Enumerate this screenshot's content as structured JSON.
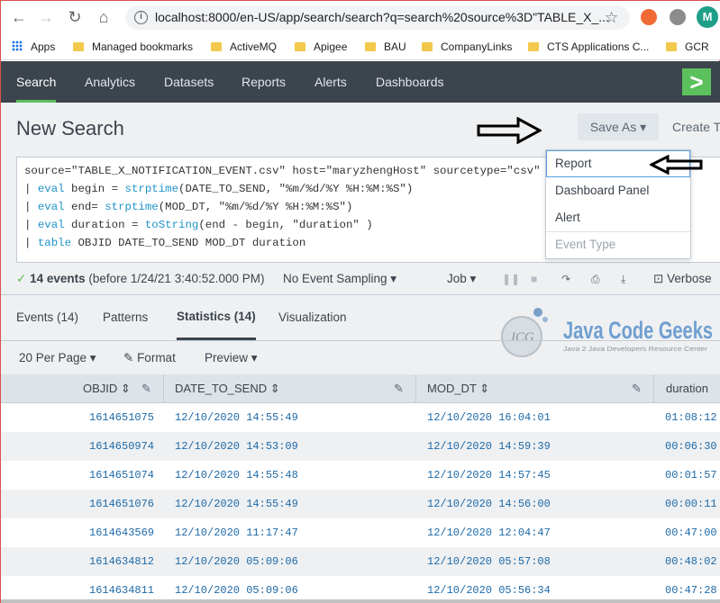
{
  "browser": {
    "url": "localhost:8000/en-US/app/search/search?q=search%20source%3D\"TABLE_X_...",
    "profile_initial": "M",
    "bookmarks": [
      "Apps",
      "Managed bookmarks",
      "ActiveMQ",
      "Apigee",
      "BAU",
      "CompanyLinks",
      "CTS Applications C...",
      "GCR"
    ]
  },
  "appbar": {
    "tabs": [
      "Search",
      "Analytics",
      "Datasets",
      "Reports",
      "Alerts",
      "Dashboards"
    ]
  },
  "page": {
    "title": "New Search",
    "save_as_label": "Save As ▾",
    "create_label": "Create T"
  },
  "search": {
    "line1": "source=\"TABLE_X_NOTIFICATION_EVENT.csv\" host=\"maryzhengHost\" sourcetype=\"csv\"",
    "line2_kw": "eval",
    "line2_rest": " begin = ",
    "line2_fn": "strptime",
    "line2_args": "(DATE_TO_SEND, \"%m/%d/%Y %H:%M:%S\")",
    "line3_kw": "eval",
    "line3_rest": " end= ",
    "line3_fn": "strptime",
    "line3_args": "(MOD_DT, \"%m/%d/%Y %H:%M:%S\")",
    "line4_kw": "eval",
    "line4_rest": " duration = ",
    "line4_fn": "toString",
    "line4_args": "(end - begin, \"duration\" )",
    "line5_kw": "table",
    "line5_rest": "  OBJID DATE_TO_SEND MOD_DT duration"
  },
  "saveas_menu": {
    "items": [
      "Report",
      "Dashboard Panel",
      "Alert",
      "Event Type"
    ]
  },
  "status": {
    "events_bold": "14 events",
    "events_rest": " (before 1/24/21 3:40:52.000 PM)",
    "sampling": "No Event Sampling ▾",
    "job": "Job ▾",
    "verbose": "Verbose"
  },
  "subtabs": [
    "Events (14)",
    "Patterns",
    "Statistics (14)",
    "Visualization"
  ],
  "toolbar": {
    "per_page": "20 Per Page ▾",
    "format": "Format",
    "preview": "Preview ▾"
  },
  "logo": {
    "main": "Java Code Geeks",
    "sub": "Java 2 Java Developers Resource Center",
    "badge": "JCG"
  },
  "table": {
    "headers": [
      "OBJID",
      "DATE_TO_SEND",
      "MOD_DT",
      "duration"
    ],
    "rows": [
      [
        "1614651075",
        "12/10/2020 14:55:49",
        "12/10/2020 16:04:01",
        "01:08:12"
      ],
      [
        "1614650974",
        "12/10/2020 14:53:09",
        "12/10/2020 14:59:39",
        "00:06:30"
      ],
      [
        "1614651074",
        "12/10/2020 14:55:48",
        "12/10/2020 14:57:45",
        "00:01:57"
      ],
      [
        "1614651076",
        "12/10/2020 14:55:49",
        "12/10/2020 14:56:00",
        "00:00:11"
      ],
      [
        "1614643569",
        "12/10/2020 11:17:47",
        "12/10/2020 12:04:47",
        "00:47:00"
      ],
      [
        "1614634812",
        "12/10/2020 05:09:06",
        "12/10/2020 05:57:08",
        "00:48:02"
      ],
      [
        "1614634811",
        "12/10/2020 05:09:06",
        "12/10/2020 05:56:34",
        "00:47:28"
      ]
    ]
  }
}
